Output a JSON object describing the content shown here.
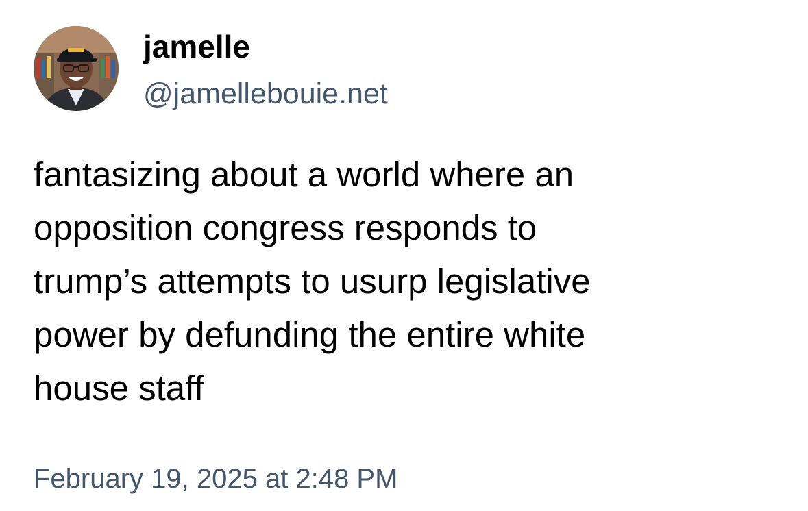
{
  "author": {
    "display_name": "jamelle",
    "handle": "@jamellebouie.net",
    "avatar_icon": "user-avatar-photo"
  },
  "post": {
    "text": "fantasizing about a world where an\nopposition congress responds to\ntrump’s attempts to usurp legislative\npower by defunding the entire white\nhouse staff",
    "timestamp": "February 19, 2025 at 2:48 PM"
  },
  "colors": {
    "text_primary": "#000000",
    "text_secondary": "#42576c",
    "background": "#ffffff"
  }
}
